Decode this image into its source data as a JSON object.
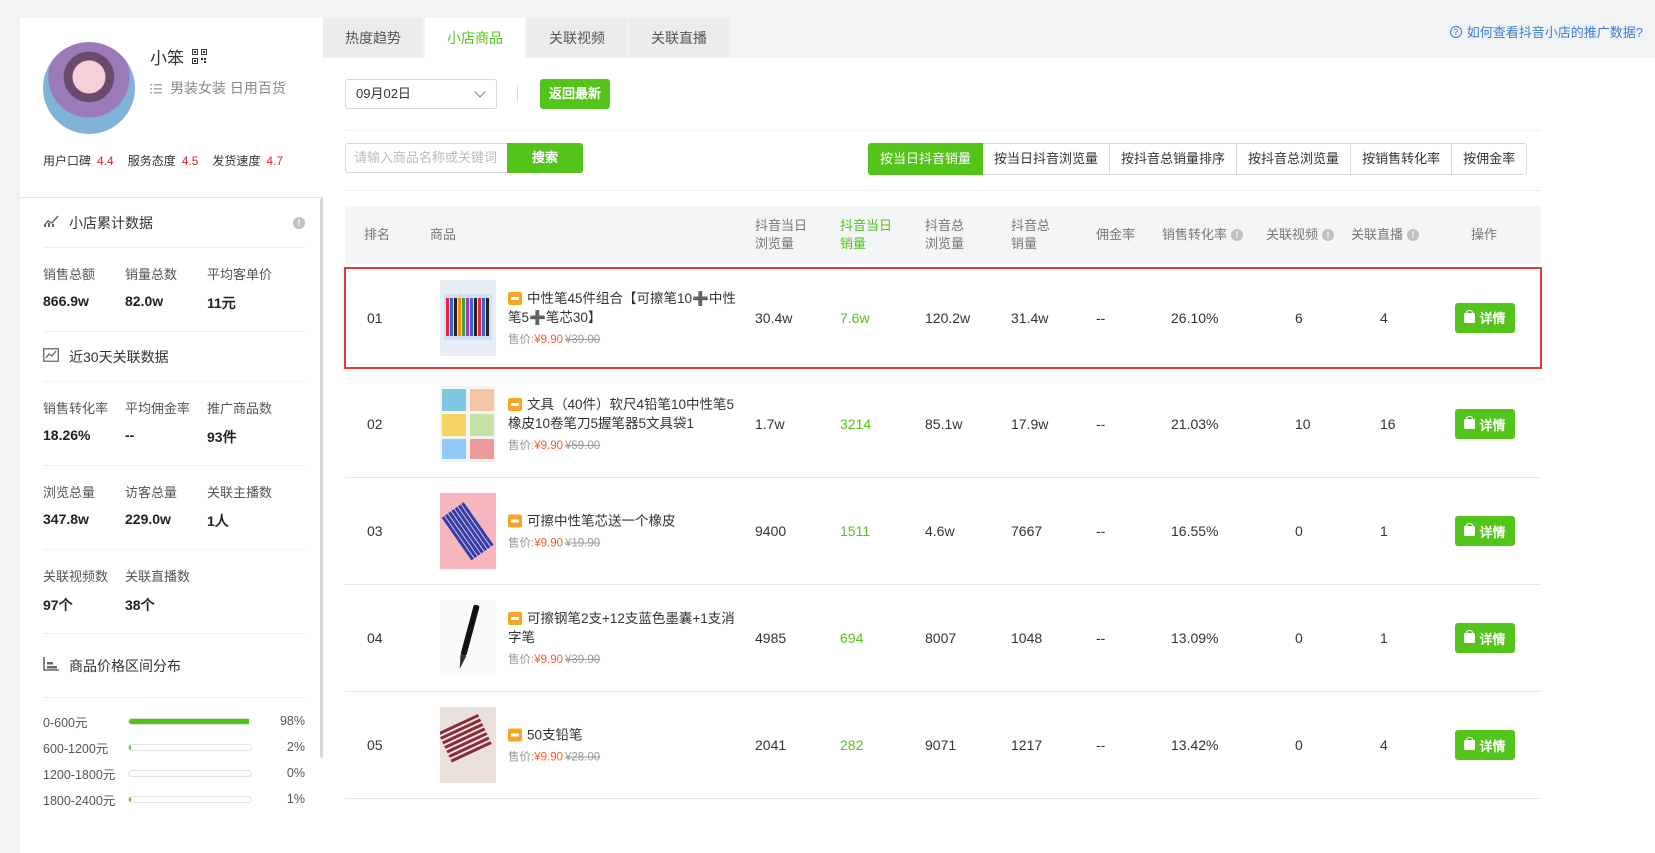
{
  "shop": {
    "name": "小笨",
    "categories": "男装女装 日用百货",
    "ratings": [
      {
        "label": "用户口碑",
        "score": "4.4"
      },
      {
        "label": "服务态度",
        "score": "4.5"
      },
      {
        "label": "发货速度",
        "score": "4.7"
      }
    ]
  },
  "sidebar": {
    "cumulative": {
      "title": "小店累计数据",
      "stats": [
        {
          "label": "销售总额",
          "value": "866.9w"
        },
        {
          "label": "销量总数",
          "value": "82.0w"
        },
        {
          "label": "平均客单价",
          "value": "11元"
        }
      ]
    },
    "recent": {
      "title": "近30天关联数据",
      "rows": [
        [
          {
            "label": "销售转化率",
            "value": "18.26%"
          },
          {
            "label": "平均佣金率",
            "value": "--"
          },
          {
            "label": "推广商品数",
            "value": "93件"
          }
        ],
        [
          {
            "label": "浏览总量",
            "value": "347.8w"
          },
          {
            "label": "访客总量",
            "value": "229.0w"
          },
          {
            "label": "关联主播数",
            "value": "1人"
          }
        ],
        [
          {
            "label": "关联视频数",
            "value": "97个"
          },
          {
            "label": "关联直播数",
            "value": "38个"
          }
        ]
      ]
    },
    "price_dist": {
      "title": "商品价格区间分布",
      "items": [
        {
          "range": "0-600元",
          "pct": "98%",
          "fraction": 0.98
        },
        {
          "range": "600-1200元",
          "pct": "2%",
          "fraction": 0.02
        },
        {
          "range": "1200-1800元",
          "pct": "0%",
          "fraction": 0.0
        },
        {
          "range": "1800-2400元",
          "pct": "1%",
          "fraction": 0.01
        }
      ]
    }
  },
  "tabs": [
    "热度趋势",
    "小店商品",
    "关联视频",
    "关联直播"
  ],
  "active_tab": 1,
  "help_link": "如何查看抖音小店的推广数据?",
  "filters": {
    "date": "09月02日",
    "back_label": "返回最新",
    "search_placeholder": "请输入商品名称或关键词",
    "search_label": "搜索",
    "sorts": [
      "按当日抖音销量",
      "按当日抖音浏览量",
      "按抖音总销量排序",
      "按抖音总浏览量",
      "按销售转化率",
      "按佣金率"
    ],
    "active_sort": 0
  },
  "table": {
    "headers": {
      "rank": "排名",
      "product": "商品",
      "day_views": [
        "抖音当日",
        "浏览量"
      ],
      "day_sales": [
        "抖音当日",
        "销量"
      ],
      "total_views": [
        "抖音总",
        "浏览量"
      ],
      "total_sales": [
        "抖音总",
        "销量"
      ],
      "commission": "佣金率",
      "conversion": "销售转化率",
      "videos": "关联视频",
      "lives": "关联直播",
      "action": "操作"
    },
    "price_prefix": "售价:",
    "detail_label": "详情",
    "rows": [
      {
        "rank": "01",
        "title": "中性笔45件组合【可擦笔10➕中性笔5➕笔芯30】",
        "price": "¥9.90",
        "old_price": "¥39.00",
        "day_views": "30.4w",
        "day_sales": "7.6w",
        "total_views": "120.2w",
        "total_sales": "31.4w",
        "commission": "--",
        "conversion": "26.10%",
        "videos": "6",
        "lives": "4",
        "highlight": true
      },
      {
        "rank": "02",
        "title": "文具（40件）软尺4铅笔10中性笔5橡皮10卷笔刀5握笔器5文具袋1",
        "price": "¥9.90",
        "old_price": "¥59.00",
        "day_views": "1.7w",
        "day_sales": "3214",
        "total_views": "85.1w",
        "total_sales": "17.9w",
        "commission": "--",
        "conversion": "21.03%",
        "videos": "10",
        "lives": "16"
      },
      {
        "rank": "03",
        "title": "可擦中性笔芯送一个橡皮",
        "price": "¥9.90",
        "old_price": "¥19.90",
        "day_views": "9400",
        "day_sales": "1511",
        "total_views": "4.6w",
        "total_sales": "7667",
        "commission": "--",
        "conversion": "16.55%",
        "videos": "0",
        "lives": "1"
      },
      {
        "rank": "04",
        "title": "可擦钢笔2支+12支蓝色墨囊+1支消字笔",
        "price": "¥9.90",
        "old_price": "¥39.90",
        "day_views": "4985",
        "day_sales": "694",
        "total_views": "8007",
        "total_sales": "1048",
        "commission": "--",
        "conversion": "13.09%",
        "videos": "0",
        "lives": "1"
      },
      {
        "rank": "05",
        "title": "50支铅笔",
        "price": "¥9.90",
        "old_price": "¥28.00",
        "day_views": "2041",
        "day_sales": "282",
        "total_views": "9071",
        "total_sales": "1217",
        "commission": "--",
        "conversion": "13.42%",
        "videos": "0",
        "lives": "4"
      }
    ]
  },
  "colors": {
    "accent": "#52c41a",
    "price": "#ff5a1f",
    "score": "#e02020",
    "highlight": "#e53935",
    "link": "#3a7bd5"
  }
}
